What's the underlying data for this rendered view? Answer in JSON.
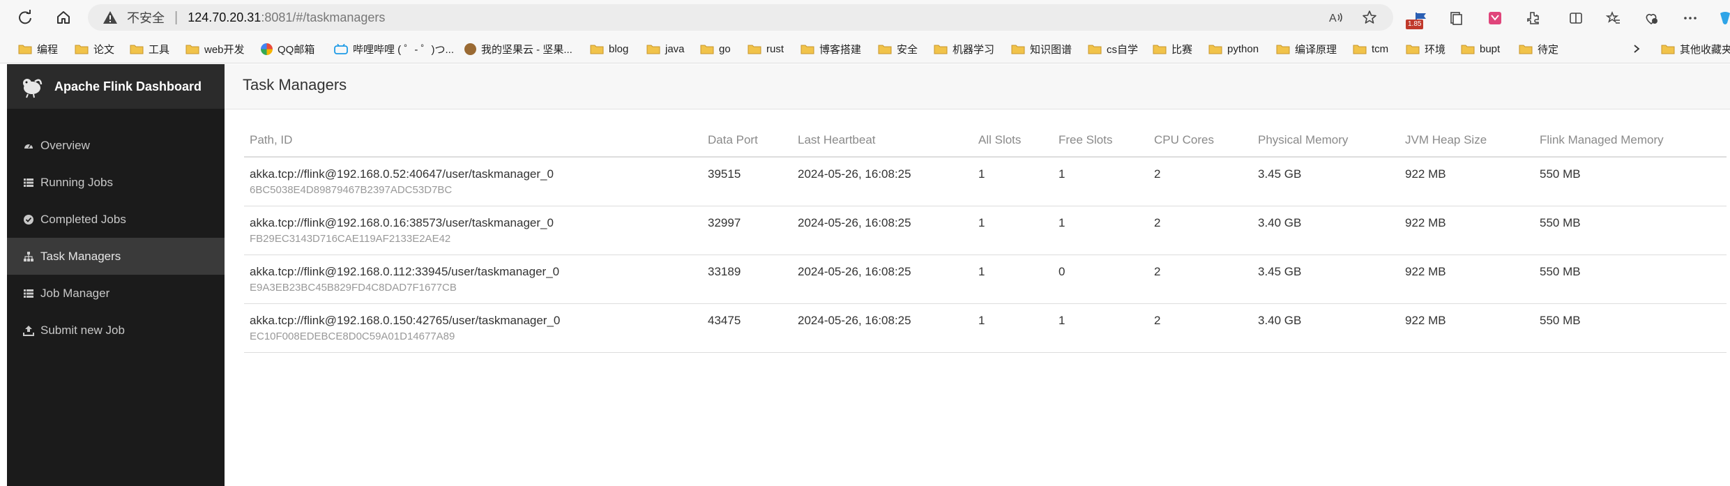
{
  "browser": {
    "security_label": "不安全",
    "url_host": "124.70.20.31",
    "url_rest": ":8081/#/taskmanagers",
    "badge": "1.85"
  },
  "bookmarks": [
    {
      "label": "编程",
      "icon": "folder-icon"
    },
    {
      "label": "论文",
      "icon": "folder-icon"
    },
    {
      "label": "工具",
      "icon": "folder-icon"
    },
    {
      "label": "web开发",
      "icon": "folder-icon"
    },
    {
      "label": "QQ邮箱",
      "icon": "qq-mail-icon"
    },
    {
      "label": "哔哩哔哩 ( ゜- ゜)つ...",
      "icon": "bilibili-icon"
    },
    {
      "label": "我的坚果云 - 坚果...",
      "icon": "nutstore-icon"
    },
    {
      "label": "blog",
      "icon": "folder-icon"
    },
    {
      "label": "java",
      "icon": "folder-icon"
    },
    {
      "label": "go",
      "icon": "folder-icon"
    },
    {
      "label": "rust",
      "icon": "folder-icon"
    },
    {
      "label": "博客搭建",
      "icon": "folder-icon"
    },
    {
      "label": "安全",
      "icon": "folder-icon"
    },
    {
      "label": "机器学习",
      "icon": "folder-icon"
    },
    {
      "label": "知识图谱",
      "icon": "folder-icon"
    },
    {
      "label": "cs自学",
      "icon": "folder-icon"
    },
    {
      "label": "比赛",
      "icon": "folder-icon"
    },
    {
      "label": "python",
      "icon": "folder-icon"
    },
    {
      "label": "编译原理",
      "icon": "folder-icon"
    },
    {
      "label": "tcm",
      "icon": "folder-icon"
    },
    {
      "label": "环境",
      "icon": "folder-icon"
    },
    {
      "label": "bupt",
      "icon": "folder-icon"
    },
    {
      "label": "待定",
      "icon": "folder-icon"
    },
    {
      "label": "其他收藏夹",
      "icon": "folder-icon"
    }
  ],
  "sidebar": {
    "title": "Apache Flink Dashboard",
    "items": [
      {
        "label": "Overview",
        "icon": "dashboard-icon",
        "active": false
      },
      {
        "label": "Running Jobs",
        "icon": "list-icon",
        "active": false
      },
      {
        "label": "Completed Jobs",
        "icon": "check-circle-icon",
        "active": false
      },
      {
        "label": "Task Managers",
        "icon": "sitemap-icon",
        "active": true
      },
      {
        "label": "Job Manager",
        "icon": "list-icon",
        "active": false
      },
      {
        "label": "Submit new Job",
        "icon": "upload-icon",
        "active": false
      }
    ]
  },
  "main": {
    "title": "Task Managers",
    "columns": [
      "Path, ID",
      "Data Port",
      "Last Heartbeat",
      "All Slots",
      "Free Slots",
      "CPU Cores",
      "Physical Memory",
      "JVM Heap Size",
      "Flink Managed Memory"
    ],
    "rows": [
      {
        "path": "akka.tcp://flink@192.168.0.52:40647/user/taskmanager_0",
        "id": "6BC5038E4D89879467B2397ADC53D7BC",
        "data_port": "39515",
        "last_heartbeat": "2024-05-26, 16:08:25",
        "all_slots": "1",
        "free_slots": "1",
        "cpu_cores": "2",
        "physical_memory": "3.45 GB",
        "jvm_heap": "922 MB",
        "flink_managed": "550 MB"
      },
      {
        "path": "akka.tcp://flink@192.168.0.16:38573/user/taskmanager_0",
        "id": "FB29EC3143D716CAE119AF2133E2AE42",
        "data_port": "32997",
        "last_heartbeat": "2024-05-26, 16:08:25",
        "all_slots": "1",
        "free_slots": "1",
        "cpu_cores": "2",
        "physical_memory": "3.40 GB",
        "jvm_heap": "922 MB",
        "flink_managed": "550 MB"
      },
      {
        "path": "akka.tcp://flink@192.168.0.112:33945/user/taskmanager_0",
        "id": "E9A3EB23BC45B829FD4C8DAD7F1677CB",
        "data_port": "33189",
        "last_heartbeat": "2024-05-26, 16:08:25",
        "all_slots": "1",
        "free_slots": "0",
        "cpu_cores": "2",
        "physical_memory": "3.45 GB",
        "jvm_heap": "922 MB",
        "flink_managed": "550 MB"
      },
      {
        "path": "akka.tcp://flink@192.168.0.150:42765/user/taskmanager_0",
        "id": "EC10F008EDEBCE8D0C59A01D14677A89",
        "data_port": "43475",
        "last_heartbeat": "2024-05-26, 16:08:25",
        "all_slots": "1",
        "free_slots": "1",
        "cpu_cores": "2",
        "physical_memory": "3.40 GB",
        "jvm_heap": "922 MB",
        "flink_managed": "550 MB"
      }
    ]
  }
}
